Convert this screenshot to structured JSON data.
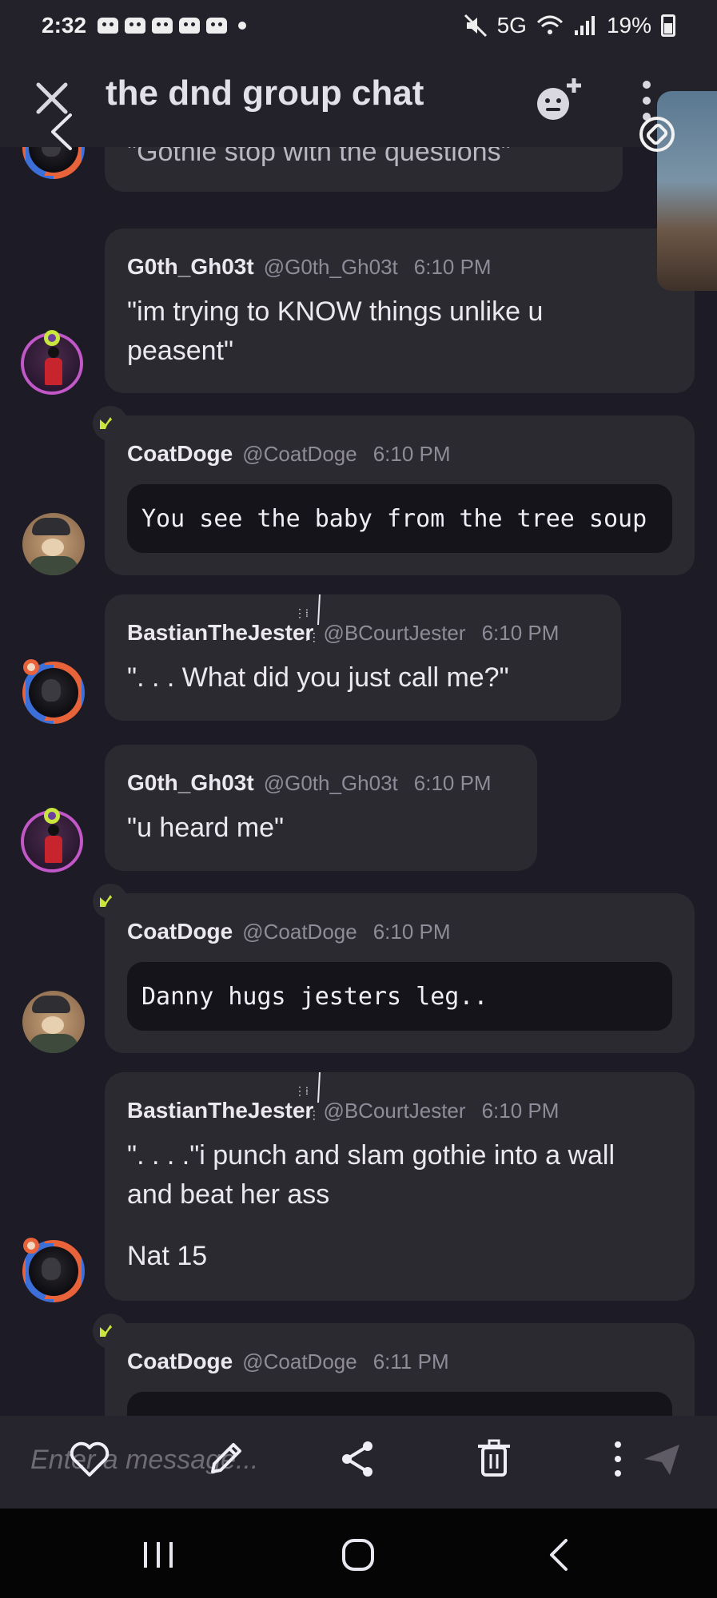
{
  "status_bar": {
    "time": "2:32",
    "network": "5G",
    "battery": "19%"
  },
  "header": {
    "title": "the dnd group chat"
  },
  "messages": [
    {
      "text": "\"Gothie stop with the questions\""
    },
    {
      "username": "G0th_Gh03t",
      "handle": "@G0th_Gh03t",
      "time": "6:10 PM",
      "text_lines": [
        "\"im trying to KNOW things unlike u",
        "peasent\""
      ]
    },
    {
      "username": "CoatDoge",
      "handle": "@CoatDoge",
      "time": "6:10 PM",
      "code": "You see the baby from the tree soup"
    },
    {
      "username": "BastianTheJester",
      "handle": "@BCourtJester",
      "time": "6:10 PM",
      "text": "\". . . What did you just call me?\""
    },
    {
      "username": "G0th_Gh03t",
      "handle": "@G0th_Gh03t",
      "time": "6:10 PM",
      "text": "\"u heard me\""
    },
    {
      "username": "CoatDoge",
      "handle": "@CoatDoge",
      "time": "6:10 PM",
      "code": "Danny hugs jesters leg.."
    },
    {
      "username": "BastianTheJester",
      "handle": "@BCourtJester",
      "time": "6:10 PM",
      "text_lines": [
        "\". . . .\"i punch and slam gothie into a wall",
        "and beat her ass"
      ],
      "extra": "Nat 15"
    },
    {
      "username": "CoatDoge",
      "handle": "@CoatDoge",
      "time": "6:11 PM"
    }
  ],
  "composer": {
    "placeholder": "Enter a message..."
  },
  "icons": {
    "close": "close-icon",
    "emoji_add": "emoji-add-icon",
    "more": "more-vertical-icon",
    "heart": "heart-icon",
    "edit": "pencil-icon",
    "share": "share-icon",
    "delete": "trash-icon",
    "send": "send-icon",
    "crown": "crown-icon"
  },
  "colors": {
    "background": "#1d1b26",
    "bubble": "#2b2a31",
    "code_block": "#15141b",
    "crown": "#c8e63b"
  }
}
